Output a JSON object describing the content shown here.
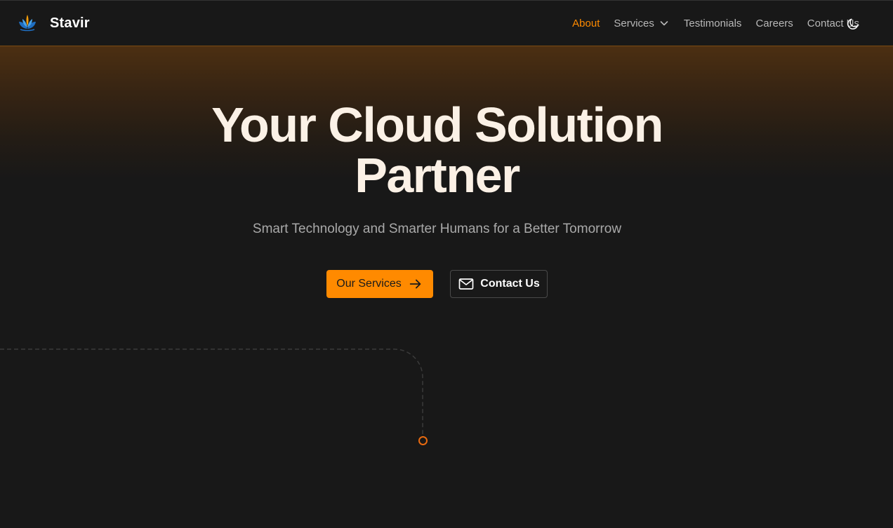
{
  "brand": {
    "name": "Stavir",
    "logo_icon": "lotus-logo-icon"
  },
  "nav": {
    "items": [
      {
        "label": "About",
        "active": true
      },
      {
        "label": "Services",
        "has_dropdown": true
      },
      {
        "label": "Testimonials"
      },
      {
        "label": "Careers"
      },
      {
        "label": "Contact Us"
      }
    ],
    "theme_toggle_icon": "moon-icon"
  },
  "hero": {
    "title_line1": "Your Cloud Solution",
    "title_line2": "Partner",
    "subtitle": "Smart Technology and Smarter Humans for a Better Tomorrow",
    "primary_button": {
      "label": "Our Services",
      "icon": "arrow-right-icon"
    },
    "secondary_button": {
      "label": "Contact Us",
      "icon": "mail-icon"
    }
  },
  "colors": {
    "accent": "#ff8a00",
    "background": "#181818",
    "title": "#fbf1e6",
    "muted_text": "#a9a9a9"
  }
}
